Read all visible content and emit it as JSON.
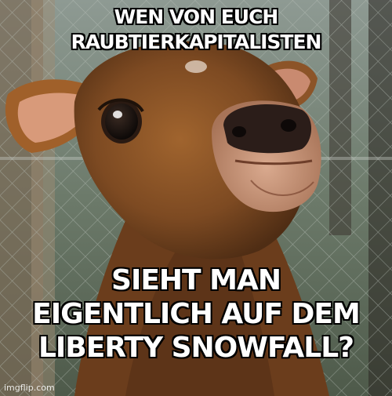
{
  "caption_top": {
    "line1": "WEN VON EUCH",
    "line2": "RAUBTIERKAPITALISTEN"
  },
  "caption_bottom": {
    "line1": "SIEHT MAN",
    "line2": "EIGENTLICH AUF DEM",
    "line3": "LIBERTY SNOWFALL?"
  },
  "watermark": "imgflip.com"
}
